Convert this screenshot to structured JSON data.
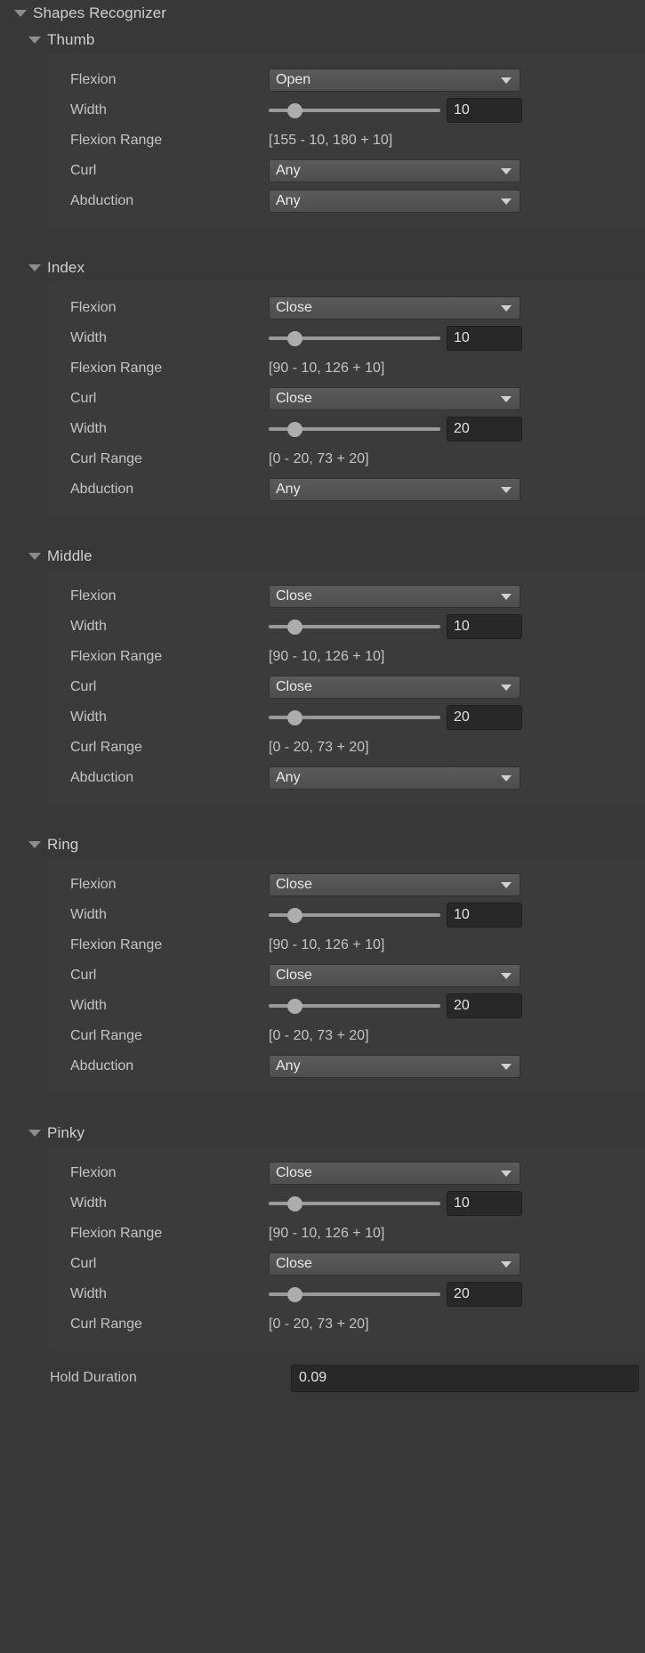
{
  "root": {
    "title": "Shapes Recognizer",
    "expanded_icon": "triangle-down-icon"
  },
  "colors": {
    "window_bg": "#383838",
    "panel_bg": "#3b3b3b",
    "dropdown_bg": "#545454",
    "field_bg": "#282828",
    "text": "#c4c4c4",
    "slider": "#9a9a9a"
  },
  "groups": [
    {
      "name": "Thumb",
      "rows": [
        {
          "kind": "dropdown",
          "label": "Flexion",
          "value": "Open"
        },
        {
          "kind": "slider",
          "label": "Width",
          "value": "10",
          "fill": 15
        },
        {
          "kind": "text",
          "label": "Flexion Range",
          "value": "[155 - 10, 180 + 10]"
        },
        {
          "kind": "dropdown",
          "label": "Curl",
          "value": "Any"
        },
        {
          "kind": "dropdown",
          "label": "Abduction",
          "value": "Any"
        }
      ]
    },
    {
      "name": "Index",
      "rows": [
        {
          "kind": "dropdown",
          "label": "Flexion",
          "value": "Close"
        },
        {
          "kind": "slider",
          "label": "Width",
          "value": "10",
          "fill": 15
        },
        {
          "kind": "text",
          "label": "Flexion Range",
          "value": "[90 - 10, 126 + 10]"
        },
        {
          "kind": "dropdown",
          "label": "Curl",
          "value": "Close"
        },
        {
          "kind": "slider",
          "label": "Width",
          "value": "20",
          "fill": 15
        },
        {
          "kind": "text",
          "label": "Curl Range",
          "value": "[0 - 20, 73 + 20]"
        },
        {
          "kind": "dropdown",
          "label": "Abduction",
          "value": "Any"
        }
      ]
    },
    {
      "name": "Middle",
      "rows": [
        {
          "kind": "dropdown",
          "label": "Flexion",
          "value": "Close"
        },
        {
          "kind": "slider",
          "label": "Width",
          "value": "10",
          "fill": 15
        },
        {
          "kind": "text",
          "label": "Flexion Range",
          "value": "[90 - 10, 126 + 10]"
        },
        {
          "kind": "dropdown",
          "label": "Curl",
          "value": "Close"
        },
        {
          "kind": "slider",
          "label": "Width",
          "value": "20",
          "fill": 15
        },
        {
          "kind": "text",
          "label": "Curl Range",
          "value": "[0 - 20, 73 + 20]"
        },
        {
          "kind": "dropdown",
          "label": "Abduction",
          "value": "Any"
        }
      ]
    },
    {
      "name": "Ring",
      "rows": [
        {
          "kind": "dropdown",
          "label": "Flexion",
          "value": "Close"
        },
        {
          "kind": "slider",
          "label": "Width",
          "value": "10",
          "fill": 15
        },
        {
          "kind": "text",
          "label": "Flexion Range",
          "value": "[90 - 10, 126 + 10]"
        },
        {
          "kind": "dropdown",
          "label": "Curl",
          "value": "Close"
        },
        {
          "kind": "slider",
          "label": "Width",
          "value": "20",
          "fill": 15
        },
        {
          "kind": "text",
          "label": "Curl Range",
          "value": "[0 - 20, 73 + 20]"
        },
        {
          "kind": "dropdown",
          "label": "Abduction",
          "value": "Any"
        }
      ]
    },
    {
      "name": "Pinky",
      "rows": [
        {
          "kind": "dropdown",
          "label": "Flexion",
          "value": "Close"
        },
        {
          "kind": "slider",
          "label": "Width",
          "value": "10",
          "fill": 15
        },
        {
          "kind": "text",
          "label": "Flexion Range",
          "value": "[90 - 10, 126 + 10]"
        },
        {
          "kind": "dropdown",
          "label": "Curl",
          "value": "Close"
        },
        {
          "kind": "slider",
          "label": "Width",
          "value": "20",
          "fill": 15
        },
        {
          "kind": "text",
          "label": "Curl Range",
          "value": "[0 - 20, 73 + 20]"
        }
      ]
    }
  ],
  "bottom": {
    "label": "Hold Duration",
    "value": "0.09"
  }
}
